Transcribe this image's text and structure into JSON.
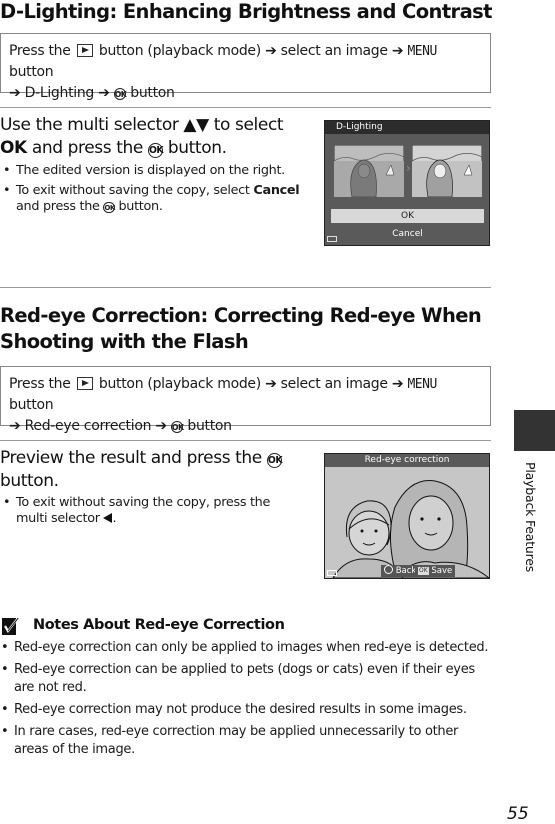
{
  "page_number": "55",
  "side_tab": {
    "label": "Playback Features"
  },
  "section1": {
    "title": "D-Lighting: Enhancing Brightness and Contrast",
    "procedure": {
      "press_the": "Press the",
      "button_playback": "button (playback mode)",
      "arrow": "➔",
      "select_image": "select an image",
      "menu": "MENU",
      "button": "button",
      "item": "D-Lighting",
      "ok_glyph": "OK",
      "button_end": "button"
    },
    "step": {
      "line1": "Use the multi selector ▲▼ to select",
      "ok_bold": "OK",
      "line2_rest": "and press the",
      "ok_glyph": "OK",
      "line2_end": "button."
    },
    "bullets": [
      {
        "text": "The edited version is displayed on the right."
      },
      {
        "pre": "To exit without saving the copy, select",
        "bold": "Cancel",
        "mid": "and press the",
        "ok_glyph": "OK",
        "post": "button."
      }
    ],
    "screen": {
      "title": "D-Lighting",
      "options": [
        "OK",
        "Cancel"
      ],
      "selected": "OK"
    }
  },
  "section2": {
    "title_line1": "Red-eye Correction: Correcting Red-eye When",
    "title_line2": "Shooting with the Flash",
    "procedure": {
      "press_the": "Press the",
      "button_playback": "button (playback mode)",
      "arrow": "➔",
      "select_image": "select an image",
      "menu": "MENU",
      "button": "button",
      "item": "Red-eye correction",
      "ok_glyph": "OK",
      "button_end": "button"
    },
    "step": {
      "line1": "Preview the result and press the",
      "ok_glyph": "OK",
      "line2": "button."
    },
    "bullets": [
      {
        "pre": "To exit without saving the copy, press the multi selector"
      }
    ],
    "screen": {
      "title": "Red-eye correction",
      "back_label": "Back",
      "save_label": "Save",
      "ok_glyph": "OK"
    }
  },
  "notes": {
    "title": "Notes About Red-eye Correction",
    "items": [
      "Red-eye correction can only be applied to images when red-eye is detected.",
      "Red-eye correction can be applied to pets (dogs or cats) even if their eyes are not red.",
      "Red-eye correction may not produce the desired results in some images.",
      "In rare cases, red-eye correction may be applied unnecessarily to other areas of the image."
    ]
  }
}
